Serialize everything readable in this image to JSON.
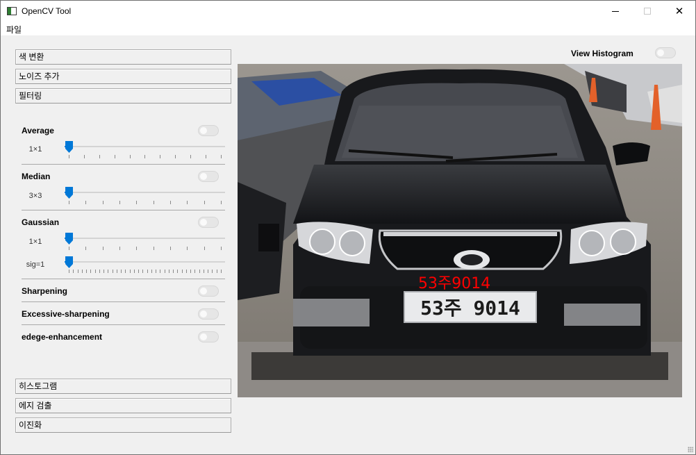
{
  "window": {
    "title": "OpenCV Tool"
  },
  "menu": {
    "items": [
      "파일"
    ]
  },
  "sidebar": {
    "top_sections": [
      "색 변환",
      "노이즈 추가",
      "필터링"
    ],
    "bottom_sections": [
      "히스토그램",
      "에지 검출",
      "이진화"
    ]
  },
  "filters": {
    "average": {
      "label": "Average",
      "enabled": false,
      "kernel_label": "1×1",
      "kernel_value": 0
    },
    "median": {
      "label": "Median",
      "enabled": false,
      "kernel_label": "3×3",
      "kernel_value": 0
    },
    "gaussian": {
      "label": "Gaussian",
      "enabled": false,
      "kernel_label": "1×1",
      "kernel_value": 0,
      "sigma_label": "sig=1",
      "sigma_value": 0
    },
    "sharpening": {
      "label": "Sharpening",
      "enabled": false
    },
    "excessive": {
      "label": "Excessive-sharpening",
      "enabled": false
    },
    "edge": {
      "label": "edege-enhancement",
      "enabled": false
    }
  },
  "histogram": {
    "label": "View Histogram",
    "enabled": false
  },
  "image": {
    "plate_text_overlay": "53주9014",
    "plate_text": "53주 9014"
  },
  "colors": {
    "accent": "#0078d7",
    "overlay_text": "#ff0000"
  }
}
